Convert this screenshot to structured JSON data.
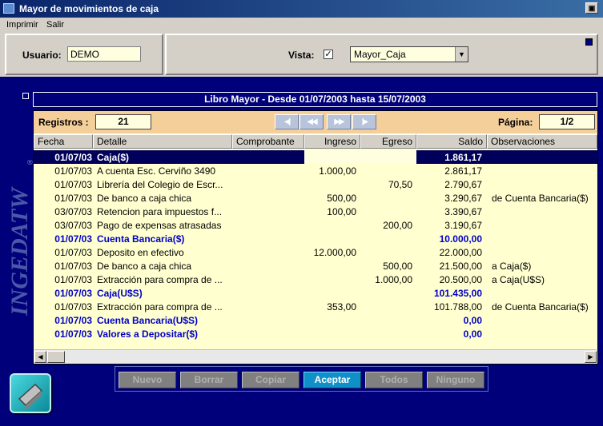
{
  "window": {
    "title": "Mayor de movimientos de caja",
    "restore_glyph": "▣"
  },
  "menu": {
    "items": [
      "Imprimir",
      "Salir"
    ]
  },
  "filters": {
    "usuario_label": "Usuario:",
    "usuario_value": "DEMO",
    "vista_label": "Vista:",
    "vista_checked": "✓",
    "vista_select": "Mayor_Caja"
  },
  "brand": {
    "text": "INGEDATW",
    "mark": "®"
  },
  "ledger": {
    "header": "Libro Mayor - Desde 01/07/2003 hasta 15/07/2003",
    "registros_label": "Registros :",
    "registros_value": "21",
    "pagina_label": "Página:",
    "pagina_value": "1/2",
    "nav": [
      "◀|",
      "◀◀",
      "▶▶",
      "|▶"
    ],
    "columns": [
      "Fecha",
      "Detalle",
      "Comprobante",
      "Ingreso",
      "Egreso",
      "Saldo",
      "Observaciones"
    ],
    "rows": [
      {
        "fecha": "01/07/03",
        "detalle": "Caja($)",
        "ingreso": "",
        "egreso": "",
        "saldo": "1.861,17",
        "obs": "",
        "kind": "sel"
      },
      {
        "fecha": "01/07/03",
        "detalle": "A cuenta Esc. Cerviño 3490",
        "ingreso": "1.000,00",
        "egreso": "",
        "saldo": "2.861,17",
        "obs": "",
        "kind": "normal"
      },
      {
        "fecha": "01/07/03",
        "detalle": "Librería del Colegio de Escr...",
        "ingreso": "",
        "egreso": "70,50",
        "saldo": "2.790,67",
        "obs": "",
        "kind": "normal"
      },
      {
        "fecha": "01/07/03",
        "detalle": "De banco a caja chica",
        "ingreso": "500,00",
        "egreso": "",
        "saldo": "3.290,67",
        "obs": "de Cuenta Bancaria($)",
        "kind": "normal"
      },
      {
        "fecha": "03/07/03",
        "detalle": "Retencion para impuestos f...",
        "ingreso": "100,00",
        "egreso": "",
        "saldo": "3.390,67",
        "obs": "",
        "kind": "normal"
      },
      {
        "fecha": "03/07/03",
        "detalle": "Pago de expensas atrasadas",
        "ingreso": "",
        "egreso": "200,00",
        "saldo": "3.190,67",
        "obs": "",
        "kind": "normal"
      },
      {
        "fecha": "01/07/03",
        "detalle": "Cuenta Bancaria($)",
        "ingreso": "",
        "egreso": "",
        "saldo": "10.000,00",
        "obs": "",
        "kind": "bold"
      },
      {
        "fecha": "01/07/03",
        "detalle": "Deposito en efectivo",
        "ingreso": "12.000,00",
        "egreso": "",
        "saldo": "22.000,00",
        "obs": "",
        "kind": "normal"
      },
      {
        "fecha": "01/07/03",
        "detalle": "De banco a caja chica",
        "ingreso": "",
        "egreso": "500,00",
        "saldo": "21.500,00",
        "obs": "a Caja($)",
        "kind": "normal"
      },
      {
        "fecha": "01/07/03",
        "detalle": "Extracción para compra de ...",
        "ingreso": "",
        "egreso": "1.000,00",
        "saldo": "20.500,00",
        "obs": "a Caja(U$S)",
        "kind": "normal"
      },
      {
        "fecha": "01/07/03",
        "detalle": "Caja(U$S)",
        "ingreso": "",
        "egreso": "",
        "saldo": "101.435,00",
        "obs": "",
        "kind": "bold"
      },
      {
        "fecha": "01/07/03",
        "detalle": "Extracción para compra de ...",
        "ingreso": "353,00",
        "egreso": "",
        "saldo": "101.788,00",
        "obs": "de Cuenta Bancaria($)",
        "kind": "normal"
      },
      {
        "fecha": "01/07/03",
        "detalle": "Cuenta Bancaria(U$S)",
        "ingreso": "",
        "egreso": "",
        "saldo": "0,00",
        "obs": "",
        "kind": "bold"
      },
      {
        "fecha": "01/07/03",
        "detalle": "Valores a Depositar($)",
        "ingreso": "",
        "egreso": "",
        "saldo": "0,00",
        "obs": "",
        "kind": "bold"
      }
    ]
  },
  "actions": {
    "buttons": [
      "Nuevo",
      "Borrar",
      "Copiar",
      "Aceptar",
      "Todos",
      "Ninguno"
    ],
    "active": "Aceptar"
  },
  "scroll": {
    "left": "◀",
    "right": "▶"
  }
}
